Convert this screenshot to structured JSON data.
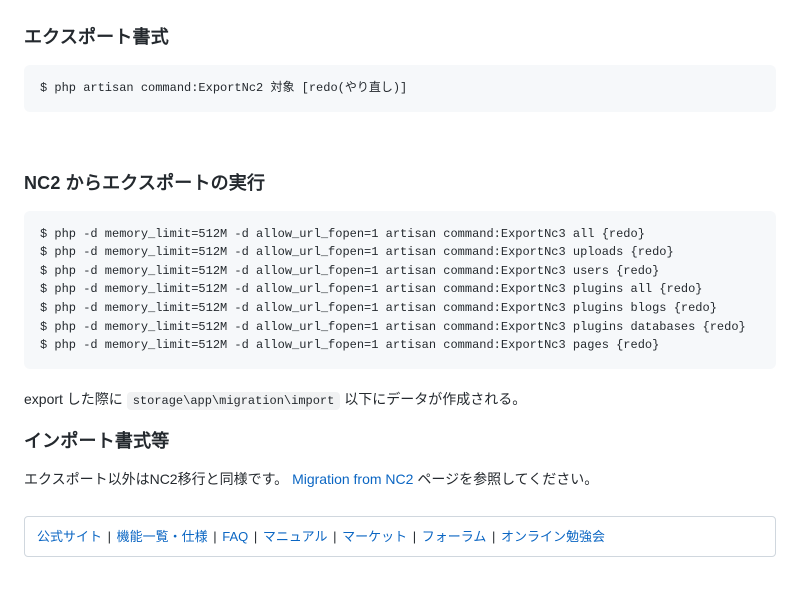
{
  "section1": {
    "heading": "エクスポート書式",
    "code": "$ php artisan command:ExportNc2 対象 [redo(やり直し)]"
  },
  "section2": {
    "heading": "NC2 からエクスポートの実行",
    "code": "$ php -d memory_limit=512M -d allow_url_fopen=1 artisan command:ExportNc3 all {redo}\n$ php -d memory_limit=512M -d allow_url_fopen=1 artisan command:ExportNc3 uploads {redo}\n$ php -d memory_limit=512M -d allow_url_fopen=1 artisan command:ExportNc3 users {redo}\n$ php -d memory_limit=512M -d allow_url_fopen=1 artisan command:ExportNc3 plugins all {redo}\n$ php -d memory_limit=512M -d allow_url_fopen=1 artisan command:ExportNc3 plugins blogs {redo}\n$ php -d memory_limit=512M -d allow_url_fopen=1 artisan command:ExportNc3 plugins databases {redo}\n$ php -d memory_limit=512M -d allow_url_fopen=1 artisan command:ExportNc3 pages {redo}"
  },
  "export_note": {
    "before": "export した際に ",
    "code": "storage\\app\\migration\\import",
    "after": " 以下にデータが作成される。"
  },
  "section3": {
    "heading": "インポート書式等",
    "text_before": "エクスポート以外はNC2移行と同様です。 ",
    "link_text": "Migration from NC2",
    "text_after": " ページを参照してください。"
  },
  "footer_links": [
    "公式サイト",
    "機能一覧・仕様",
    "FAQ",
    "マニュアル",
    "マーケット",
    "フォーラム",
    "オンライン勉強会"
  ],
  "footer_sep": " | "
}
